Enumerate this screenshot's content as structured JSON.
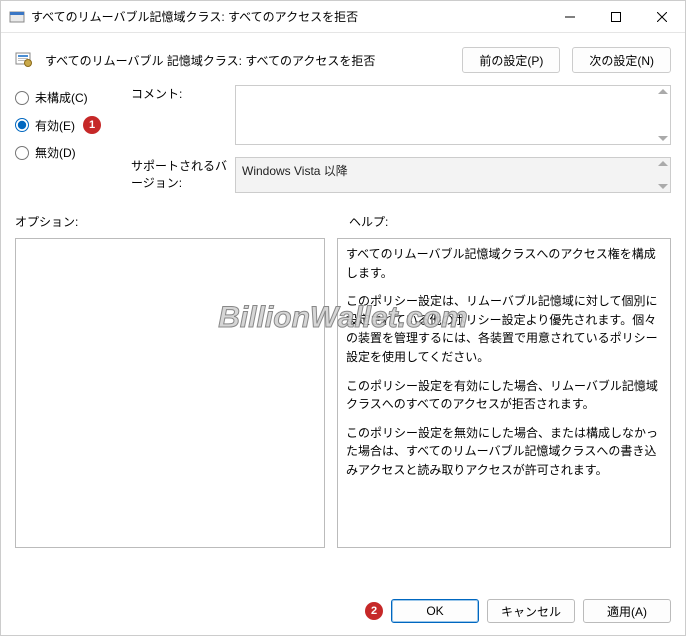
{
  "window": {
    "title": "すべてのリムーバブル記憶域クラス: すべてのアクセスを拒否",
    "minimize": "—",
    "maximize": "□",
    "close": "×"
  },
  "header": {
    "policy_title": "すべてのリムーバブル 記憶域クラス: すべてのアクセスを拒否",
    "prev": "前の設定(P)",
    "next": "次の設定(N)"
  },
  "radios": {
    "not_configured": "未構成(C)",
    "enabled": "有効(E)",
    "disabled": "無効(D)",
    "selected": "enabled"
  },
  "callouts": {
    "enabled": "1",
    "ok": "2"
  },
  "fields": {
    "comment_label": "コメント:",
    "comment_value": "",
    "support_label": "サポートされるバージョン:",
    "support_value": "Windows Vista 以降"
  },
  "panels": {
    "options_label": "オプション:",
    "help_label": "ヘルプ:",
    "help_paragraphs": [
      "すべてのリムーバブル記憶域クラスへのアクセス権を構成します。",
      "このポリシー設定は、リムーバブル記憶域に対して個別に設定されている他のポリシー設定より優先されます。個々の装置を管理するには、各装置で用意されているポリシー設定を使用してください。",
      "このポリシー設定を有効にした場合、リムーバブル記憶域クラスへのすべてのアクセスが拒否されます。",
      "このポリシー設定を無効にした場合、または構成しなかった場合は、すべてのリムーバブル記憶域クラスへの書き込みアクセスと読み取りアクセスが許可されます。"
    ]
  },
  "footer": {
    "ok": "OK",
    "cancel": "キャンセル",
    "apply": "適用(A)"
  },
  "watermark": "BillionWallet.com"
}
